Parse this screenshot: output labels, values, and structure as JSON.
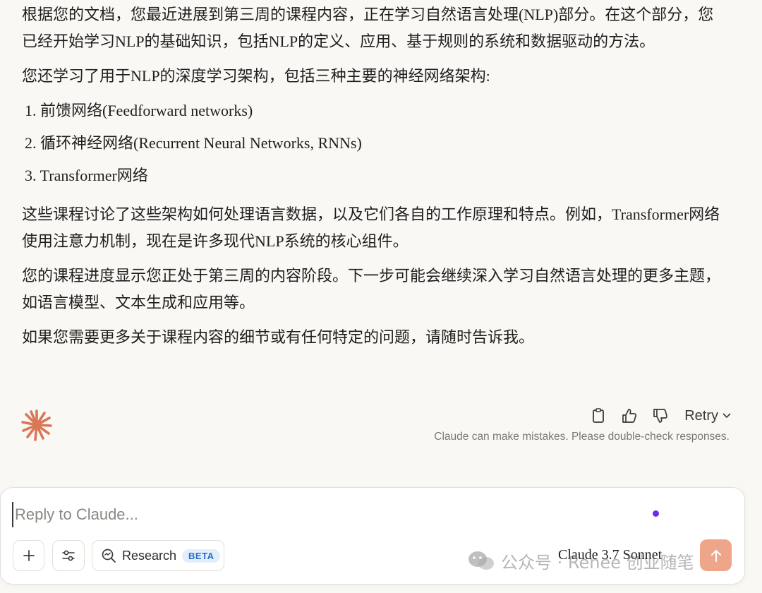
{
  "message": {
    "paragraphs_before": [
      "根据您的文档，您最近进展到第三周的课程内容，正在学习自然语言处理(NLP)部分。在这个部分，您已经开始学习NLP的基础知识，包括NLP的定义、应用、基于规则的系统和数据驱动的方法。",
      "您还学习了用于NLP的深度学习架构，包括三种主要的神经网络架构:"
    ],
    "list": [
      {
        "num": "1.",
        "text": "前馈网络(Feedforward networks)"
      },
      {
        "num": "2.",
        "text": "循环神经网络(Recurrent Neural Networks, RNNs)"
      },
      {
        "num": "3.",
        "text": "Transformer网络"
      }
    ],
    "paragraphs_after": [
      "这些课程讨论了这些架构如何处理语言数据，以及它们各自的工作原理和特点。例如，Transformer网络使用注意力机制，现在是许多现代NLP系统的核心组件。",
      "您的课程进度显示您正处于第三周的内容阶段。下一步可能会继续深入学习自然语言处理的更多主题，如语言模型、文本生成和应用等。",
      "如果您需要更多关于课程内容的细节或有任何特定的问题，请随时告诉我。"
    ]
  },
  "actions": {
    "retry_label": "Retry",
    "disclaimer": "Claude can make mistakes. Please double-check responses."
  },
  "composer": {
    "placeholder": "Reply to Claude...",
    "research_label": "Research",
    "beta_badge": "BETA",
    "model": "Claude 3.7 Sonnet"
  },
  "watermark": {
    "text": "公众号 · Renee 创业随笔"
  },
  "colors": {
    "background": "#f9f8f5",
    "claude_logo": "#d97757",
    "send_button": "#efa58a",
    "beta_text": "#2d6cc7",
    "dot": "#6a2cf0"
  },
  "icons": [
    "claude-logo-icon",
    "copy-icon",
    "thumbs-up-icon",
    "thumbs-down-icon",
    "chevron-down-icon",
    "plus-icon",
    "sliders-icon",
    "research-icon",
    "arrow-up-icon",
    "wechat-icon"
  ]
}
